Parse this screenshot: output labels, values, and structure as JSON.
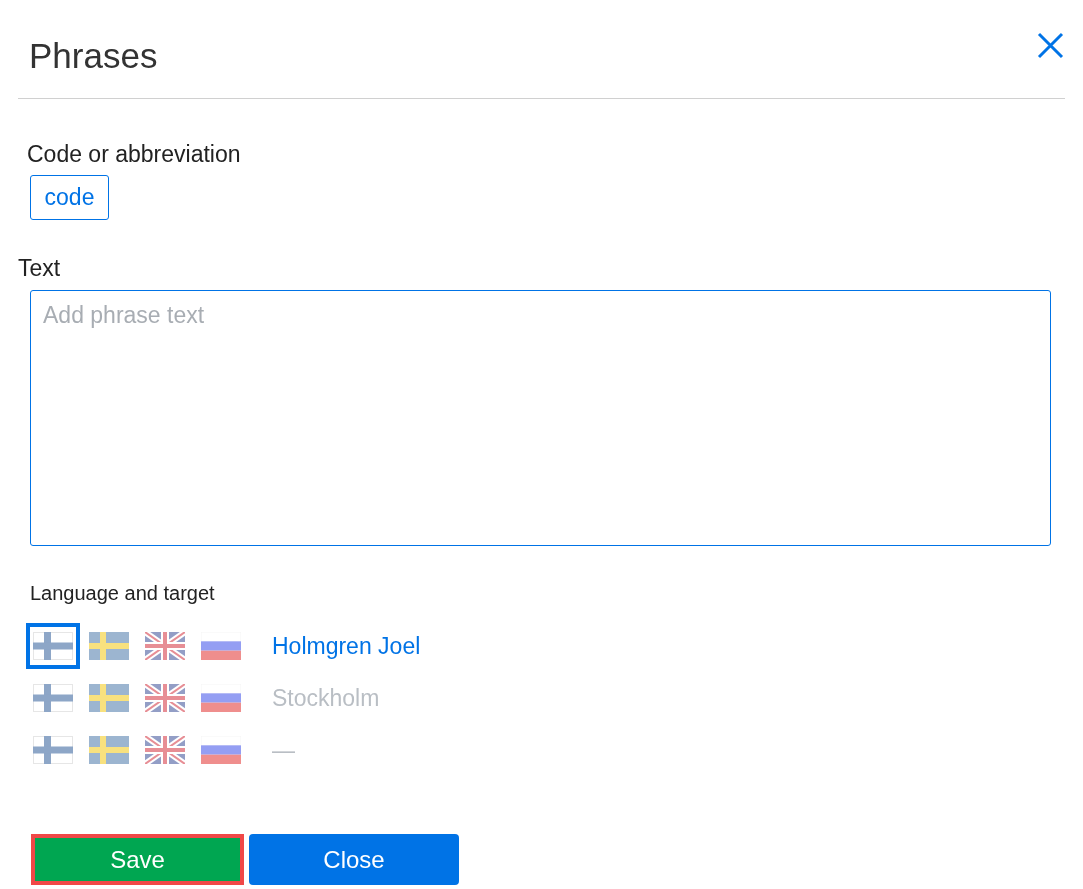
{
  "dialog": {
    "title": "Phrases"
  },
  "code_field": {
    "label": "Code or abbreviation",
    "value": "code"
  },
  "text_field": {
    "label": "Text",
    "placeholder": "Add phrase text"
  },
  "language": {
    "label": "Language and target",
    "rows": [
      {
        "selected": true,
        "target": "Holmgren Joel",
        "flags": [
          {
            "kind": "fi",
            "selected": true
          },
          {
            "kind": "sv",
            "selected": false
          },
          {
            "kind": "en",
            "selected": false
          },
          {
            "kind": "ru",
            "selected": false
          }
        ]
      },
      {
        "selected": false,
        "target": "Stockholm",
        "flags": [
          {
            "kind": "fi",
            "selected": false
          },
          {
            "kind": "sv",
            "selected": false
          },
          {
            "kind": "en",
            "selected": false
          },
          {
            "kind": "ru",
            "selected": false
          }
        ]
      },
      {
        "selected": false,
        "target": "—",
        "flags": [
          {
            "kind": "fi",
            "selected": false
          },
          {
            "kind": "sv",
            "selected": false
          },
          {
            "kind": "en",
            "selected": false
          },
          {
            "kind": "ru",
            "selected": false
          }
        ]
      }
    ]
  },
  "buttons": [
    {
      "kind": "save",
      "label": "Save",
      "focused": true
    },
    {
      "kind": "close",
      "label": "Close",
      "focused": false
    }
  ]
}
